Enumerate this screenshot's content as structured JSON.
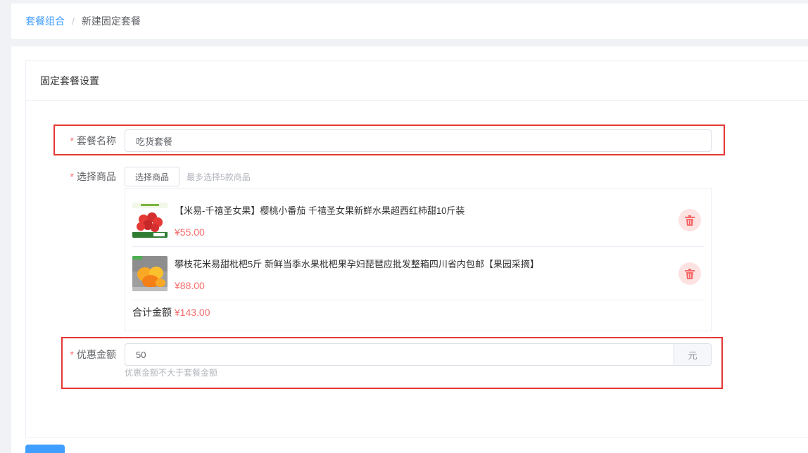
{
  "breadcrumb": {
    "parent": "套餐组合",
    "separator": "/",
    "current": "新建固定套餐"
  },
  "card": {
    "title": "固定套餐设置"
  },
  "form": {
    "name_label": "套餐名称",
    "name_value": "吃货套餐",
    "goods_label": "选择商品",
    "select_button": "选择商品",
    "select_hint": "最多选择5款商品",
    "goods": [
      {
        "title": "【米易-千禧圣女果】樱桃小番茄 千禧圣女果新鲜水果超西红柿甜10斤装",
        "price": "¥55.00",
        "thumb_icon": "tomato-thumb"
      },
      {
        "title": "攀枝花米易甜枇杷5斤 新鲜当季水果枇杷果孕妇琵琶应批发整箱四川省内包邮【果园采摘】",
        "price": "¥88.00",
        "thumb_icon": "loquat-thumb"
      }
    ],
    "total_label": "合计金额",
    "total_value": "¥143.00",
    "discount_label": "优惠金额",
    "discount_value": "50",
    "discount_unit": "元",
    "discount_hint": "优惠金额不大于套餐金额",
    "required_mark": "*"
  },
  "colors": {
    "accent": "#409eff",
    "price": "#f56c6c",
    "highlight_box": "#e53935"
  }
}
